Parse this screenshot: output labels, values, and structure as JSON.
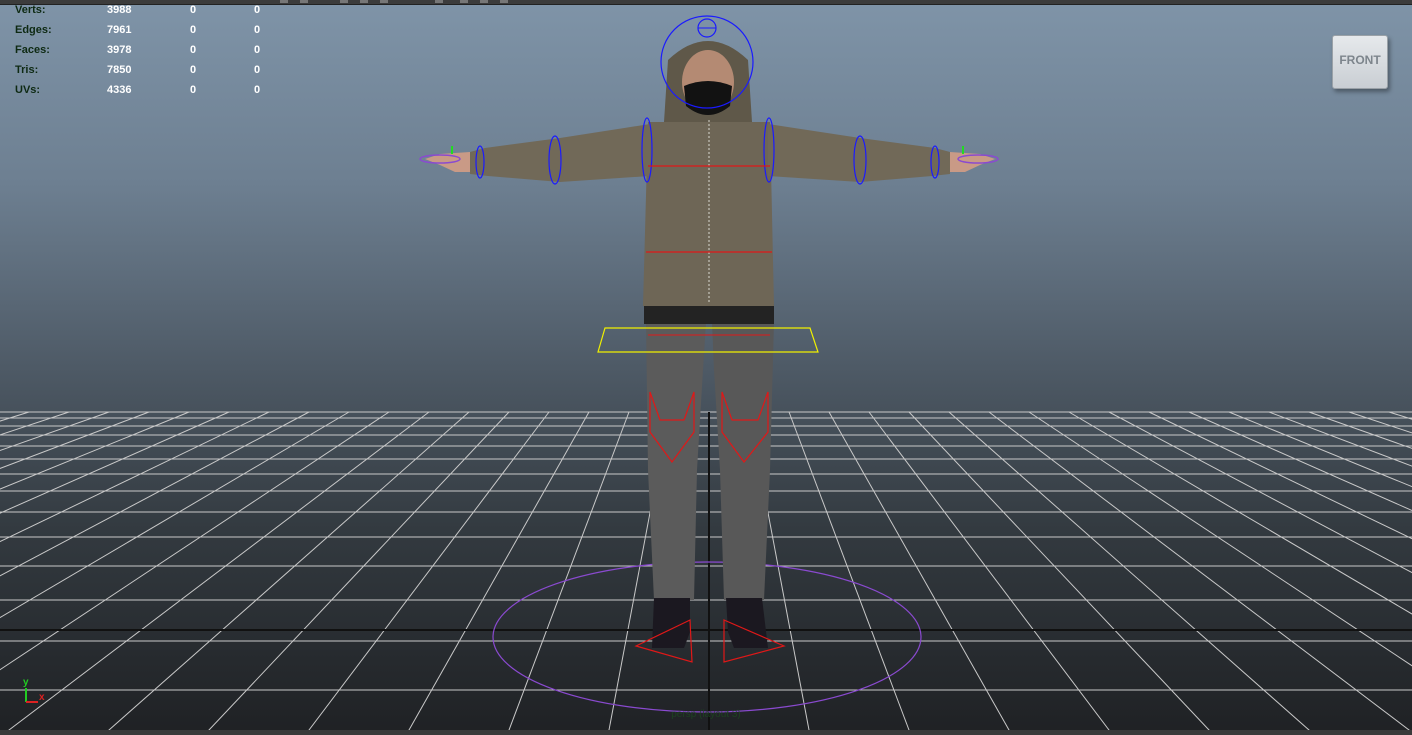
{
  "hud": {
    "rows": [
      {
        "label": "Verts:",
        "v1": "3988",
        "v2": "0",
        "v3": "0"
      },
      {
        "label": "Edges:",
        "v1": "7961",
        "v2": "0",
        "v3": "0"
      },
      {
        "label": "Faces:",
        "v1": "3978",
        "v2": "0",
        "v3": "0"
      },
      {
        "label": "Tris:",
        "v1": "7850",
        "v2": "0",
        "v3": "0"
      },
      {
        "label": "UVs:",
        "v1": "4336",
        "v2": "0",
        "v3": "0"
      }
    ]
  },
  "viewcube": {
    "label": "FRONT"
  },
  "camera": {
    "label": "persp (layout 3)"
  },
  "axis": {
    "y_label": "y",
    "x_label": "x"
  },
  "colors": {
    "hud_label": "#0e2a13",
    "hud_value": "#ffffff",
    "grid": "#c9c9c9",
    "selection_yellow": "#f0f000",
    "control_red": "#e01818",
    "control_blue": "#1a1aff",
    "control_purple": "#8a4ad0"
  }
}
